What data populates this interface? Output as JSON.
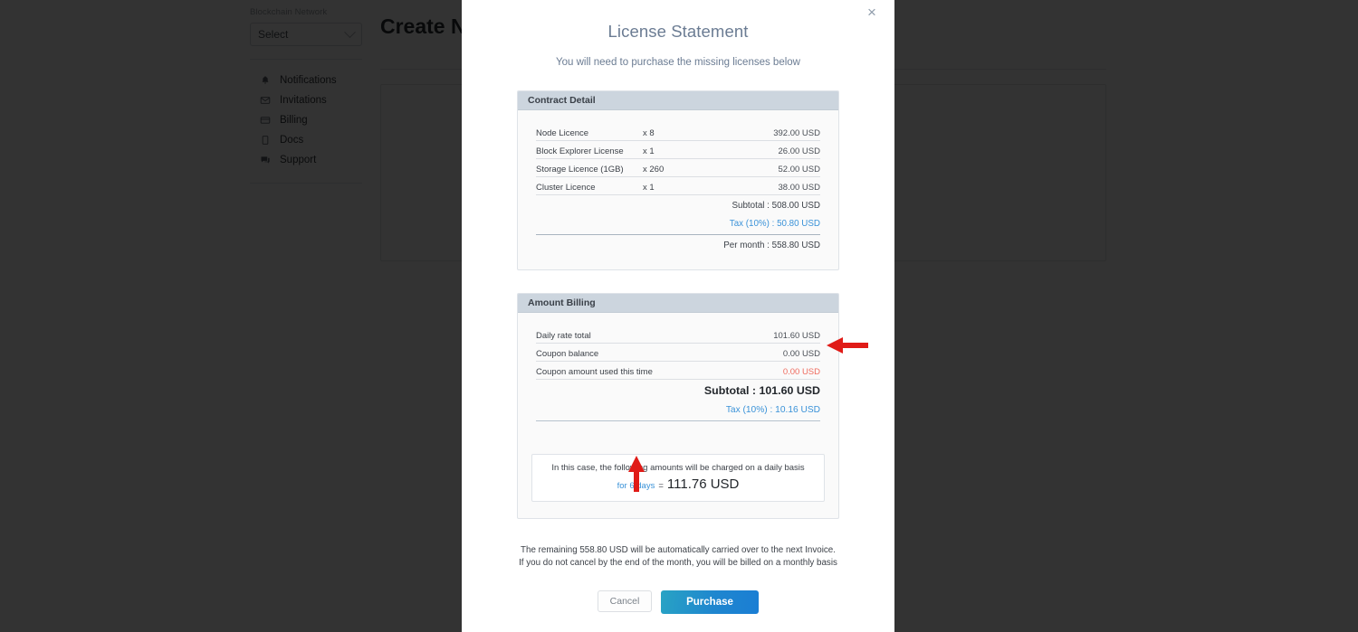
{
  "background": {
    "sidebar": {
      "group_label": "Blockchain Network",
      "select_value": "Select",
      "items": [
        {
          "label": "Notifications",
          "icon": "bell-icon"
        },
        {
          "label": "Invitations",
          "icon": "envelope-icon"
        },
        {
          "label": "Billing",
          "icon": "credit-card-icon"
        },
        {
          "label": "Docs",
          "icon": "document-icon"
        },
        {
          "label": "Support",
          "icon": "chat-icon"
        }
      ]
    },
    "page_title": "Create New"
  },
  "modal": {
    "close_label": "×",
    "title": "License Statement",
    "subtitle": "You will need to purchase the missing licenses below",
    "contract": {
      "header": "Contract Detail",
      "rows": [
        {
          "name": "Node Licence",
          "qty": "x 8",
          "amount": "392.00 USD"
        },
        {
          "name": "Block Explorer License",
          "qty": "x 1",
          "amount": "26.00 USD"
        },
        {
          "name": "Storage Licence (1GB)",
          "qty": "x 260",
          "amount": "52.00 USD"
        },
        {
          "name": "Cluster Licence",
          "qty": "x 1",
          "amount": "38.00 USD"
        }
      ],
      "subtotal": "Subtotal : 508.00 USD",
      "tax": "Tax (10%) : 50.80 USD",
      "per_month": "Per month : 558.80 USD"
    },
    "billing": {
      "header": "Amount Billing",
      "rows": [
        {
          "name": "Daily rate total",
          "amount": "101.60 USD",
          "red": false
        },
        {
          "name": "Coupon balance",
          "amount": "0.00 USD",
          "red": false
        },
        {
          "name": "Coupon amount used this time",
          "amount": "0.00 USD",
          "red": true
        }
      ],
      "subtotal": "Subtotal : 101.60 USD",
      "tax": "Tax (10%) : 10.16 USD",
      "daily_note": "In this case, the following amounts will be charged on a daily basis",
      "daily_days": "for 6 days",
      "daily_eq": "=",
      "daily_amount": "111.76 USD"
    },
    "footnote_line1": "The remaining 558.80 USD will be automatically carried over to the next Invoice.",
    "footnote_line2": "If you do not cancel by the end of the month, you will be billed on a monthly basis",
    "cancel_label": "Cancel",
    "purchase_label": "Purchase"
  },
  "annotations": {
    "arrow_left_name": "red-arrow-pointing-to-coupon-balance",
    "arrow_up_name": "red-arrow-pointing-to-for-6-days",
    "color": "#e01b17"
  },
  "colors": {
    "accent_blue": "#3a92d8",
    "header_bg": "#ccd5de",
    "title_slate": "#6b7c93",
    "alert_red": "#ef6b5e",
    "purchase_gradient_start": "#28a3c4",
    "purchase_gradient_end": "#1a7ed4"
  }
}
